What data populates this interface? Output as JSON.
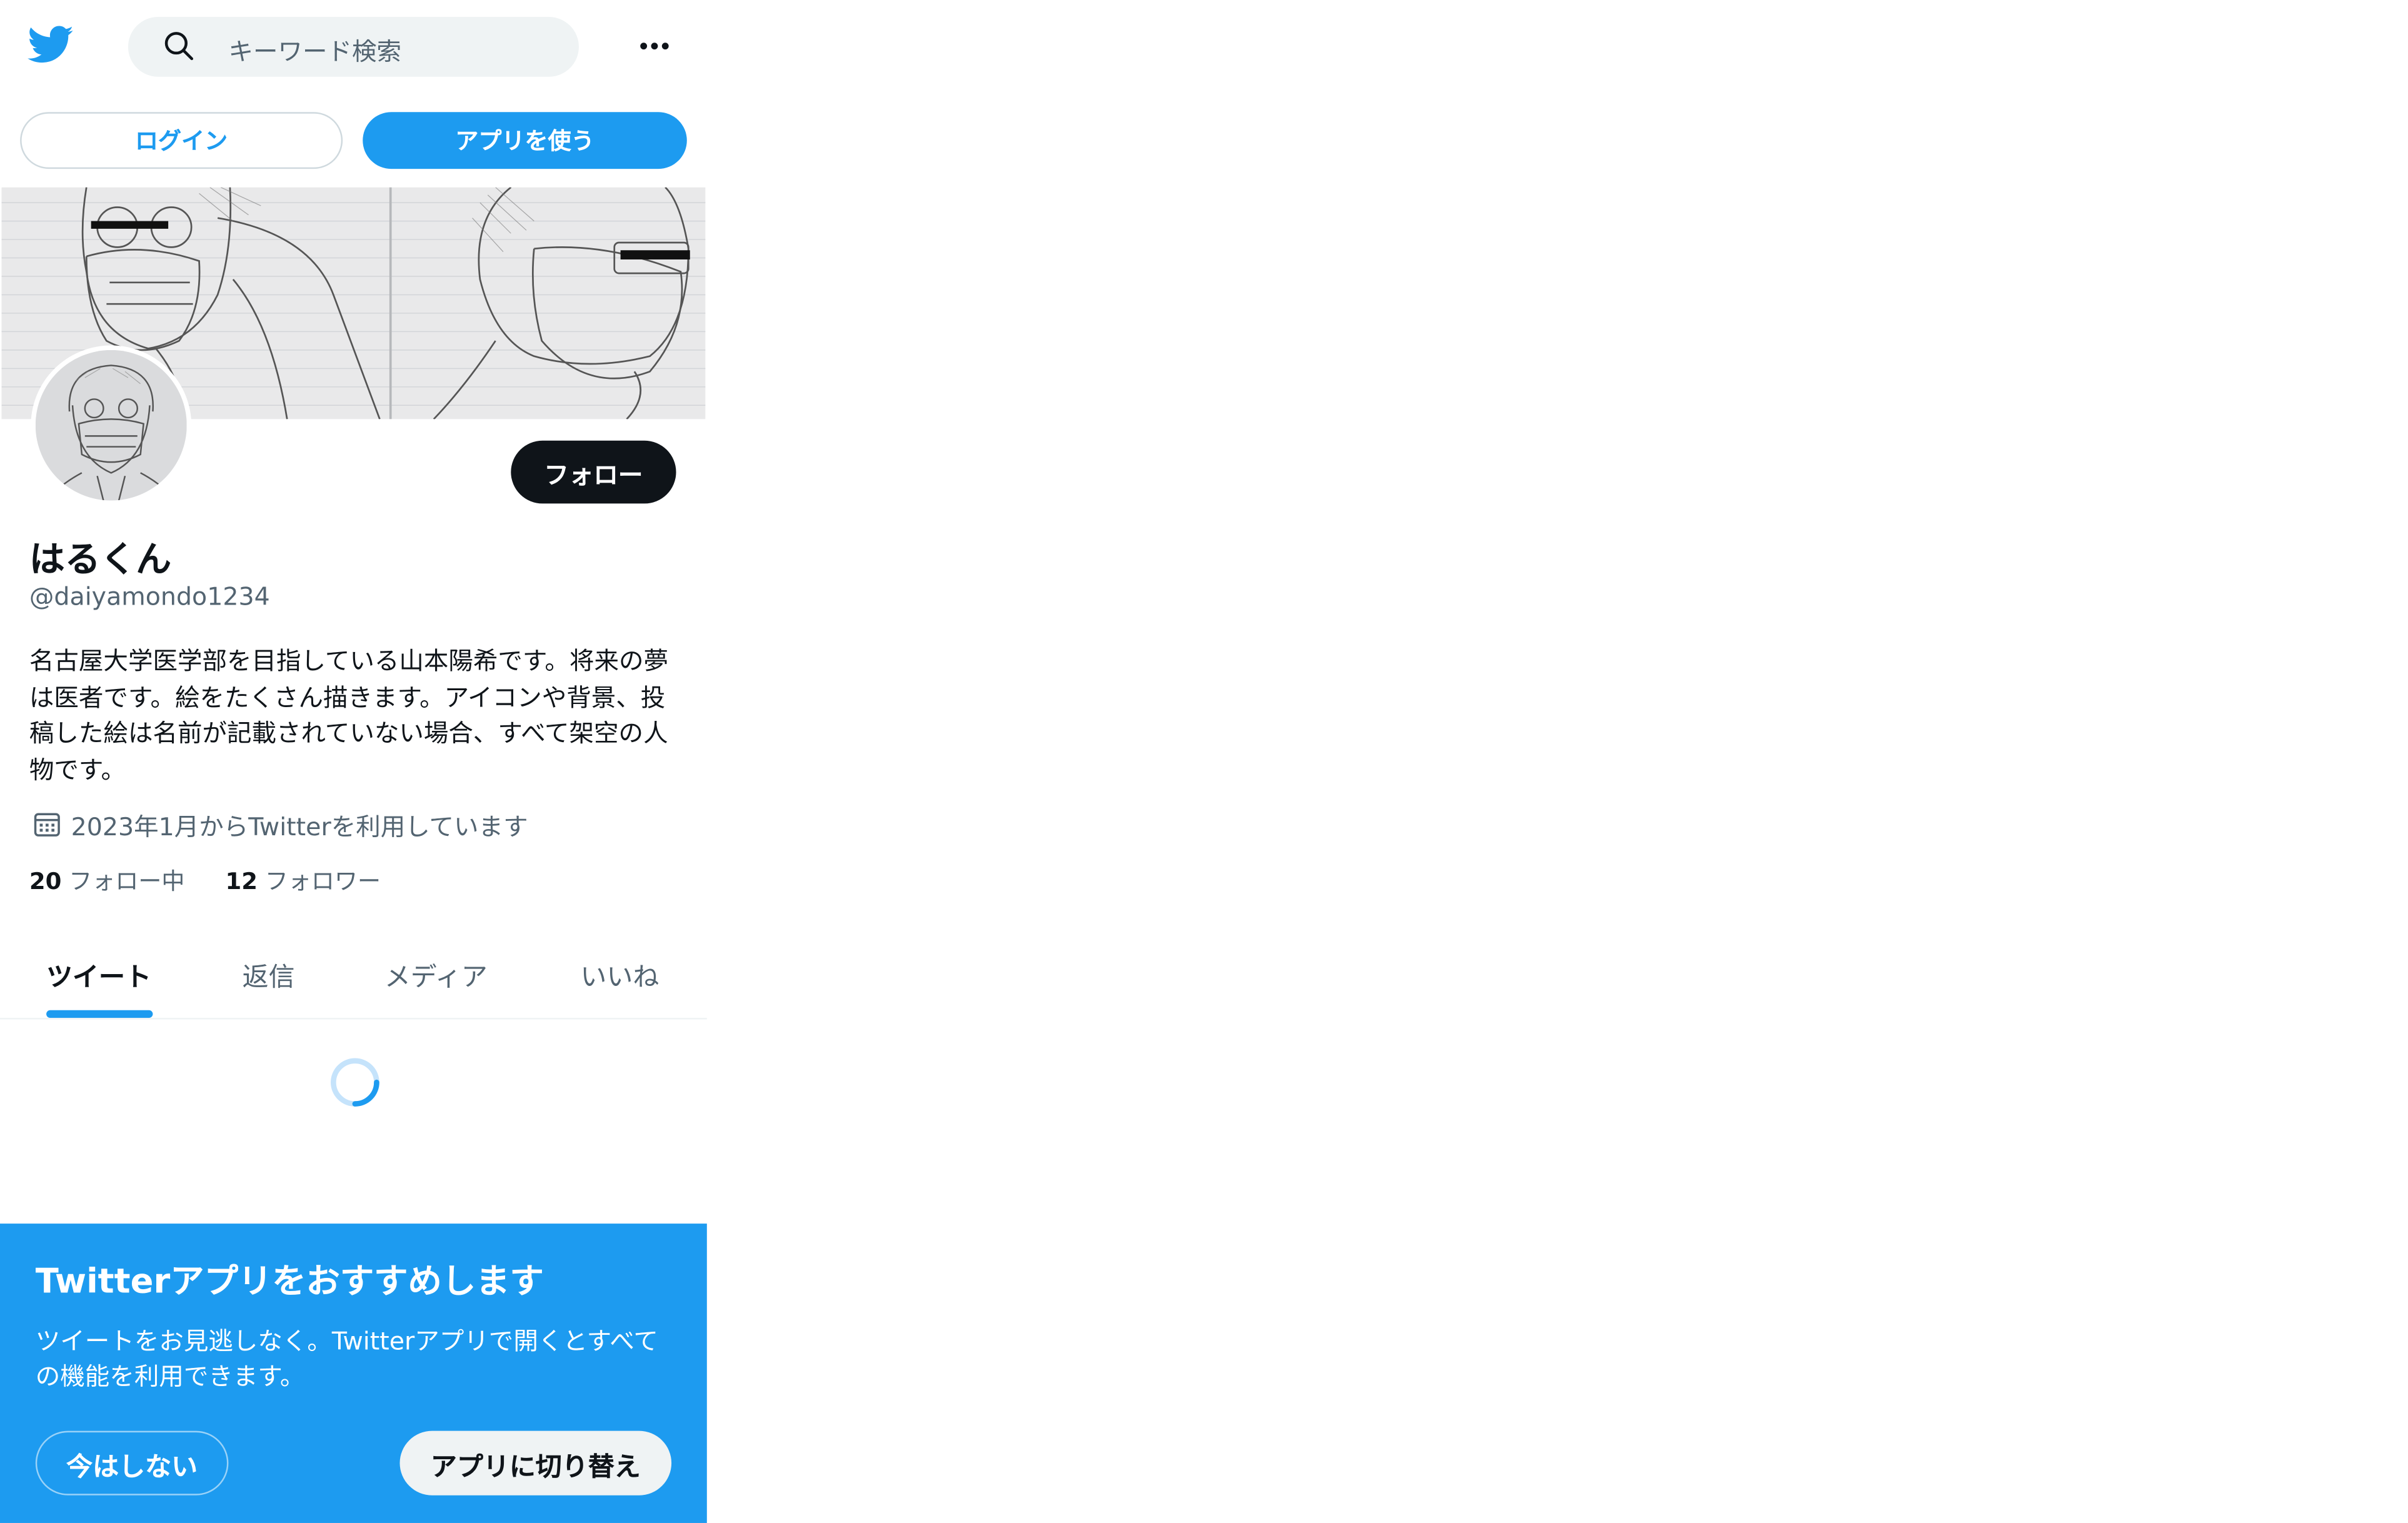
{
  "header": {
    "search_placeholder": "キーワード検索",
    "logo_icon": "twitter-bird-icon",
    "more_icon": "more-dots-icon"
  },
  "auth": {
    "login_label": "ログイン",
    "use_app_label": "アプリを使う"
  },
  "profile": {
    "follow_label": "フォロー",
    "display_name": "はるくん",
    "handle": "@daiyamondo1234",
    "bio": "名古屋大学医学部を目指している山本陽希です。将来の夢は医者です。絵をたくさん描きます。アイコンや背景、投稿した絵は名前が記載されていない場合、すべて架空の人物です。",
    "joined": "2023年1月からTwitterを利用しています",
    "following_count": "20",
    "following_label": "フォロー中",
    "followers_count": "12",
    "followers_label": "フォロワー"
  },
  "tabs": [
    {
      "label": "ツイート",
      "active": true
    },
    {
      "label": "返信",
      "active": false
    },
    {
      "label": "メディア",
      "active": false
    },
    {
      "label": "いいね",
      "active": false
    }
  ],
  "promo": {
    "title": "Twitterアプリをおすすめします",
    "body": "ツイートをお見逃しなく。Twitterアプリで開くとすべての機能を利用できます。",
    "not_now_label": "今はしない",
    "switch_label": "アプリに切り替え"
  },
  "colors": {
    "accent": "#1d9bf0",
    "text_primary": "#0f1419",
    "text_secondary": "#536471",
    "search_bg": "#eff3f4"
  }
}
